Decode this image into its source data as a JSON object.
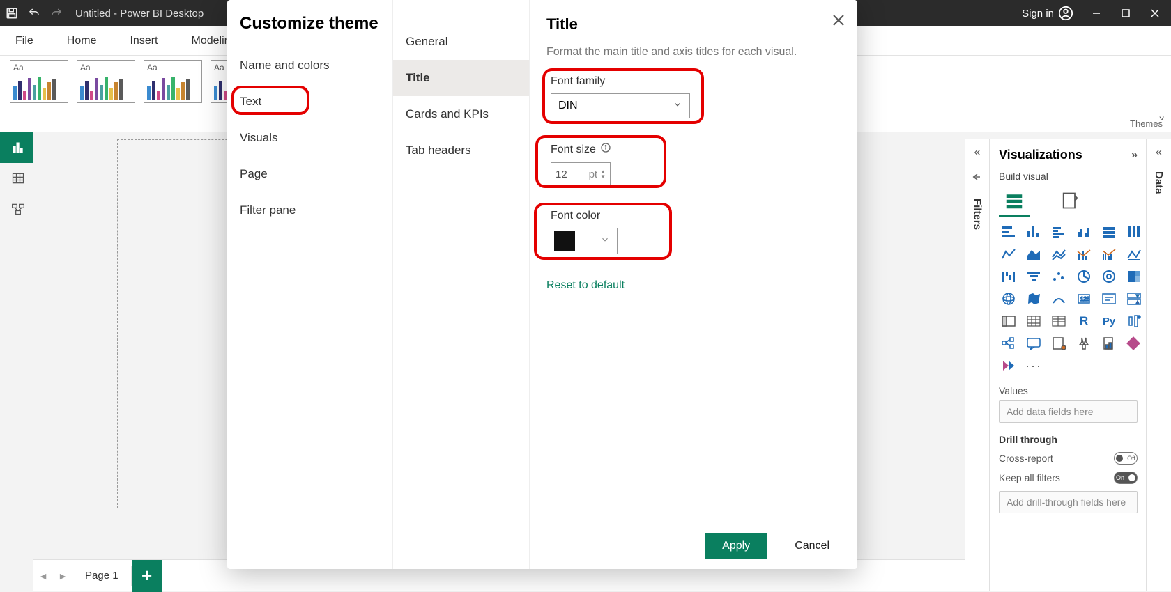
{
  "titlebar": {
    "app_title": "Untitled - Power BI Desktop",
    "sign_in": "Sign in"
  },
  "ribbon": {
    "file": "File",
    "home": "Home",
    "insert": "Insert",
    "modeling": "Modelin"
  },
  "themes": {
    "aa": "Aa",
    "label": "Themes"
  },
  "pagetabs": {
    "page1": "Page 1"
  },
  "dialog": {
    "title": "Customize theme",
    "nav1": {
      "name_colors": "Name and colors",
      "text": "Text",
      "visuals": "Visuals",
      "page": "Page",
      "filter_pane": "Filter pane"
    },
    "nav2": {
      "general": "General",
      "title": "Title",
      "cards": "Cards and KPIs",
      "tab_headers": "Tab headers"
    },
    "panel": {
      "heading": "Title",
      "desc": "Format the main title and axis titles for each visual.",
      "font_family_label": "Font family",
      "font_family_value": "DIN",
      "font_size_label": "Font size",
      "font_size_value": "12",
      "font_size_unit": "pt",
      "font_color_label": "Font color",
      "font_color_value": "#111111",
      "reset": "Reset to default"
    },
    "footer": {
      "apply": "Apply",
      "cancel": "Cancel"
    }
  },
  "vispane": {
    "title": "Visualizations",
    "build": "Build visual",
    "values": "Values",
    "values_placeholder": "Add data fields here",
    "drill": "Drill through",
    "cross": "Cross-report",
    "cross_state": "Off",
    "keep": "Keep all filters",
    "keep_state": "On",
    "drill_placeholder": "Add drill-through fields here"
  },
  "filters_label": "Filters",
  "data_label": "Data",
  "expand_caret": "^"
}
